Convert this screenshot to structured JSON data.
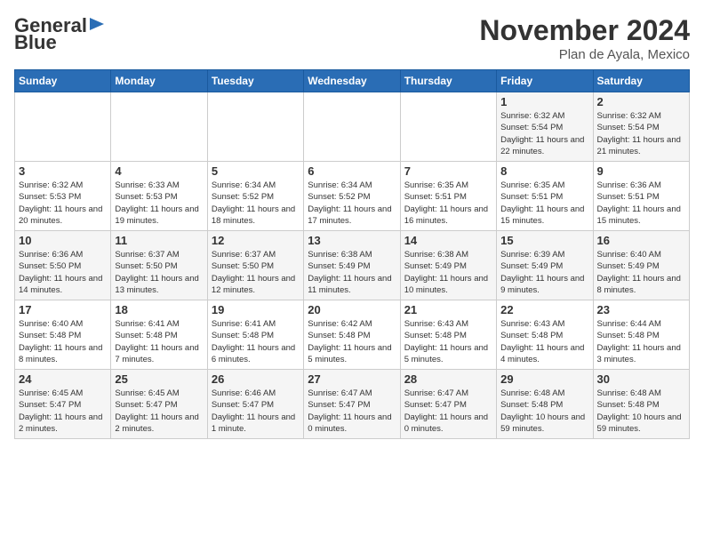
{
  "header": {
    "logo_general": "General",
    "logo_blue": "Blue",
    "month_title": "November 2024",
    "location": "Plan de Ayala, Mexico"
  },
  "weekdays": [
    "Sunday",
    "Monday",
    "Tuesday",
    "Wednesday",
    "Thursday",
    "Friday",
    "Saturday"
  ],
  "weeks": [
    [
      {
        "day": "",
        "info": ""
      },
      {
        "day": "",
        "info": ""
      },
      {
        "day": "",
        "info": ""
      },
      {
        "day": "",
        "info": ""
      },
      {
        "day": "",
        "info": ""
      },
      {
        "day": "1",
        "info": "Sunrise: 6:32 AM\nSunset: 5:54 PM\nDaylight: 11 hours and 22 minutes."
      },
      {
        "day": "2",
        "info": "Sunrise: 6:32 AM\nSunset: 5:54 PM\nDaylight: 11 hours and 21 minutes."
      }
    ],
    [
      {
        "day": "3",
        "info": "Sunrise: 6:32 AM\nSunset: 5:53 PM\nDaylight: 11 hours and 20 minutes."
      },
      {
        "day": "4",
        "info": "Sunrise: 6:33 AM\nSunset: 5:53 PM\nDaylight: 11 hours and 19 minutes."
      },
      {
        "day": "5",
        "info": "Sunrise: 6:34 AM\nSunset: 5:52 PM\nDaylight: 11 hours and 18 minutes."
      },
      {
        "day": "6",
        "info": "Sunrise: 6:34 AM\nSunset: 5:52 PM\nDaylight: 11 hours and 17 minutes."
      },
      {
        "day": "7",
        "info": "Sunrise: 6:35 AM\nSunset: 5:51 PM\nDaylight: 11 hours and 16 minutes."
      },
      {
        "day": "8",
        "info": "Sunrise: 6:35 AM\nSunset: 5:51 PM\nDaylight: 11 hours and 15 minutes."
      },
      {
        "day": "9",
        "info": "Sunrise: 6:36 AM\nSunset: 5:51 PM\nDaylight: 11 hours and 15 minutes."
      }
    ],
    [
      {
        "day": "10",
        "info": "Sunrise: 6:36 AM\nSunset: 5:50 PM\nDaylight: 11 hours and 14 minutes."
      },
      {
        "day": "11",
        "info": "Sunrise: 6:37 AM\nSunset: 5:50 PM\nDaylight: 11 hours and 13 minutes."
      },
      {
        "day": "12",
        "info": "Sunrise: 6:37 AM\nSunset: 5:50 PM\nDaylight: 11 hours and 12 minutes."
      },
      {
        "day": "13",
        "info": "Sunrise: 6:38 AM\nSunset: 5:49 PM\nDaylight: 11 hours and 11 minutes."
      },
      {
        "day": "14",
        "info": "Sunrise: 6:38 AM\nSunset: 5:49 PM\nDaylight: 11 hours and 10 minutes."
      },
      {
        "day": "15",
        "info": "Sunrise: 6:39 AM\nSunset: 5:49 PM\nDaylight: 11 hours and 9 minutes."
      },
      {
        "day": "16",
        "info": "Sunrise: 6:40 AM\nSunset: 5:49 PM\nDaylight: 11 hours and 8 minutes."
      }
    ],
    [
      {
        "day": "17",
        "info": "Sunrise: 6:40 AM\nSunset: 5:48 PM\nDaylight: 11 hours and 8 minutes."
      },
      {
        "day": "18",
        "info": "Sunrise: 6:41 AM\nSunset: 5:48 PM\nDaylight: 11 hours and 7 minutes."
      },
      {
        "day": "19",
        "info": "Sunrise: 6:41 AM\nSunset: 5:48 PM\nDaylight: 11 hours and 6 minutes."
      },
      {
        "day": "20",
        "info": "Sunrise: 6:42 AM\nSunset: 5:48 PM\nDaylight: 11 hours and 5 minutes."
      },
      {
        "day": "21",
        "info": "Sunrise: 6:43 AM\nSunset: 5:48 PM\nDaylight: 11 hours and 5 minutes."
      },
      {
        "day": "22",
        "info": "Sunrise: 6:43 AM\nSunset: 5:48 PM\nDaylight: 11 hours and 4 minutes."
      },
      {
        "day": "23",
        "info": "Sunrise: 6:44 AM\nSunset: 5:48 PM\nDaylight: 11 hours and 3 minutes."
      }
    ],
    [
      {
        "day": "24",
        "info": "Sunrise: 6:45 AM\nSunset: 5:47 PM\nDaylight: 11 hours and 2 minutes."
      },
      {
        "day": "25",
        "info": "Sunrise: 6:45 AM\nSunset: 5:47 PM\nDaylight: 11 hours and 2 minutes."
      },
      {
        "day": "26",
        "info": "Sunrise: 6:46 AM\nSunset: 5:47 PM\nDaylight: 11 hours and 1 minute."
      },
      {
        "day": "27",
        "info": "Sunrise: 6:47 AM\nSunset: 5:47 PM\nDaylight: 11 hours and 0 minutes."
      },
      {
        "day": "28",
        "info": "Sunrise: 6:47 AM\nSunset: 5:47 PM\nDaylight: 11 hours and 0 minutes."
      },
      {
        "day": "29",
        "info": "Sunrise: 6:48 AM\nSunset: 5:48 PM\nDaylight: 10 hours and 59 minutes."
      },
      {
        "day": "30",
        "info": "Sunrise: 6:48 AM\nSunset: 5:48 PM\nDaylight: 10 hours and 59 minutes."
      }
    ]
  ]
}
